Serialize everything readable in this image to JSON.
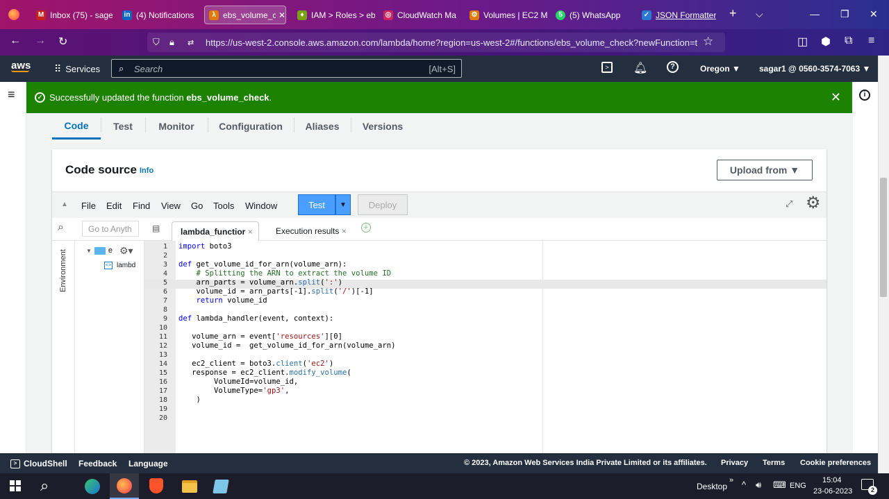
{
  "browser": {
    "tabs": [
      {
        "label": "Inbox (75) - sage",
        "icon_color": "#c5221f",
        "glyph": "M"
      },
      {
        "label": "(4) Notifications",
        "icon_color": "#0a66c2",
        "glyph": "in"
      },
      {
        "label": "ebs_volume_cl",
        "icon_color": "#e07b00",
        "glyph": "λ"
      },
      {
        "label": "IAM > Roles > eb",
        "icon_color": "#7aa116",
        "glyph": "♦"
      },
      {
        "label": "CloudWatch Ma",
        "icon_color": "#d0245e",
        "glyph": "◎"
      },
      {
        "label": "Volumes | EC2 M",
        "icon_color": "#e07b00",
        "glyph": "⚙"
      },
      {
        "label": "(5) WhatsApp",
        "icon_color": "#25d366",
        "glyph": "5"
      },
      {
        "label": "JSON Formatter",
        "icon_color": "#2a7ad2",
        "glyph": "✓"
      }
    ],
    "url": "https://us-west-2.console.aws.amazon.com/lambda/home?region=us-west-2#/functions/ebs_volume_check?newFunction=t"
  },
  "aws": {
    "logo": "aws",
    "services_label": "Services",
    "search_placeholder": "Search",
    "search_shortcut": "[Alt+S]",
    "region": "Oregon ▼",
    "account": "sagar1 @ 0560-3574-7063 ▼"
  },
  "banner": {
    "prefix": "Successfully updated the function ",
    "function_name": "ebs_volume_check",
    "suffix": "."
  },
  "content_tabs": [
    "Code",
    "Test",
    "Monitor",
    "Configuration",
    "Aliases",
    "Versions"
  ],
  "code_source": {
    "title": "Code source",
    "info": "Info",
    "upload_label": "Upload from ▼"
  },
  "editor": {
    "menu": [
      "File",
      "Edit",
      "Find",
      "View",
      "Go",
      "Tools",
      "Window"
    ],
    "test_label": "Test",
    "deploy_label": "Deploy",
    "goto_placeholder": "Go to Anyth",
    "file_tabs": [
      "lambda_functior",
      "Execution results"
    ],
    "env_label": "Environment",
    "tree_folder": "e",
    "tree_file": "lambd",
    "lines": [
      "import boto3",
      "",
      "def get_volume_id_for_arn(volume_arn):",
      "    # Splitting the ARN to extract the volume ID",
      "    arn_parts = volume_arn.split(':')",
      "    volume_id = arn_parts[-1].split('/')[-1]",
      "    return volume_id",
      "",
      "def lambda_handler(event, context):",
      "",
      "   volume_arn = event['resources'][0]",
      "   volume_id =  get_volume_id_for_arn(volume_arn)",
      "",
      "   ec2_client = boto3.client('ec2')",
      "   response = ec2_client.modify_volume(",
      "        VolumeId=volume_id,",
      "        VolumeType='gp3',",
      "    )",
      "",
      ""
    ]
  },
  "footer": {
    "cloudshell": "CloudShell",
    "feedback": "Feedback",
    "language": "Language",
    "copyright": "© 2023, Amazon Web Services India Private Limited or its affiliates.",
    "links": [
      "Privacy",
      "Terms",
      "Cookie preferences"
    ]
  },
  "taskbar": {
    "desktop": "Desktop",
    "lang": "ENG",
    "time": "15:04",
    "date": "23-06-2023",
    "notif_count": "2"
  }
}
